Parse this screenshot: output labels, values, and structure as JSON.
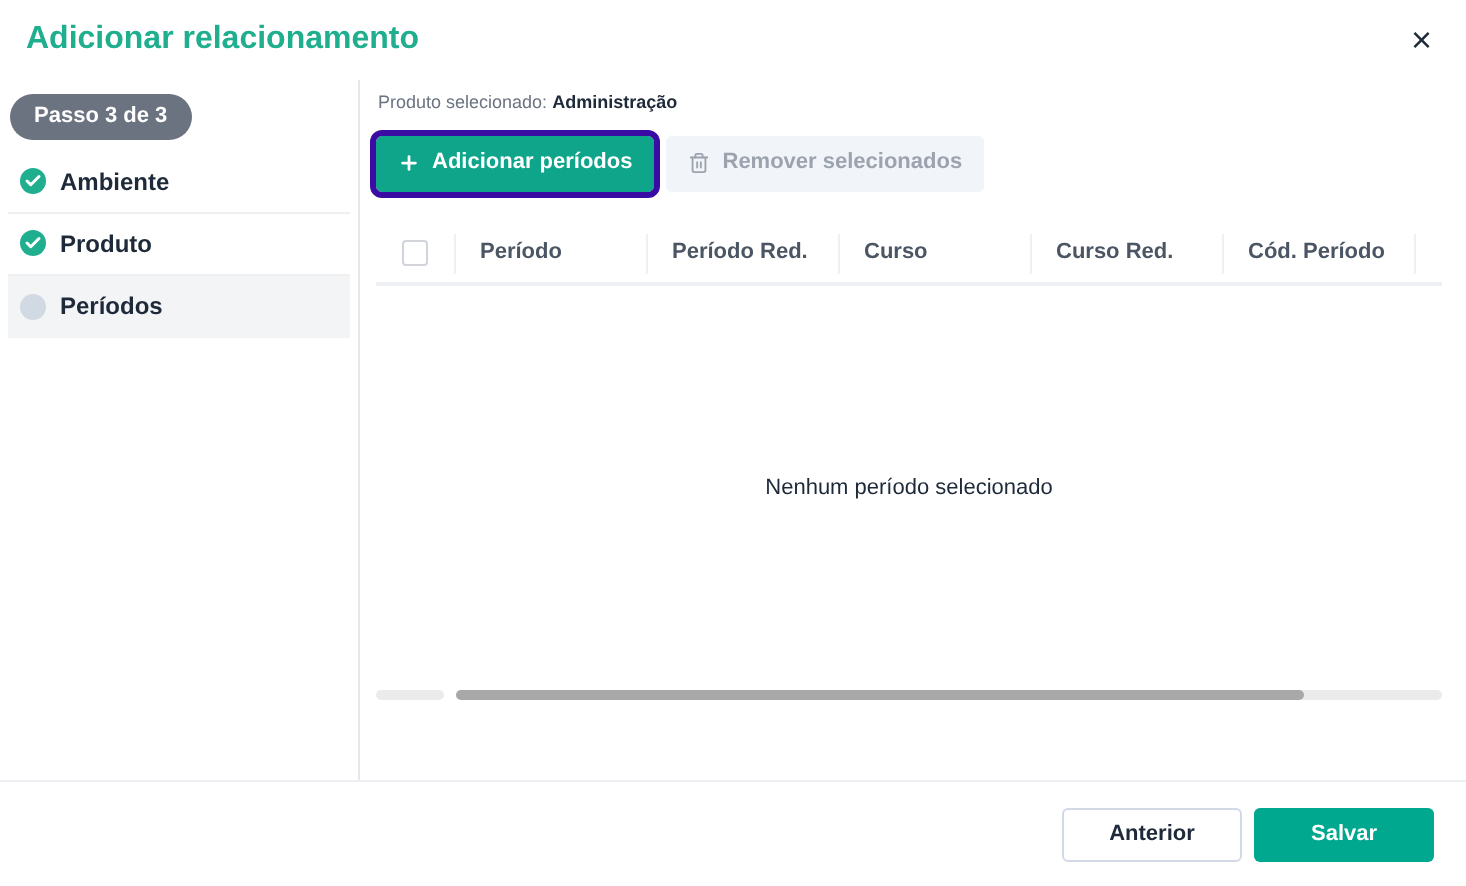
{
  "dialog": {
    "title": "Adicionar relacionamento",
    "close": "×"
  },
  "stepper": {
    "badge": "Passo 3 de 3",
    "steps": [
      {
        "label": "Ambiente",
        "completed": true,
        "selected": false
      },
      {
        "label": "Produto",
        "completed": true,
        "selected": false
      },
      {
        "label": "Períodos",
        "completed": false,
        "selected": true
      }
    ]
  },
  "selected_product": {
    "label": "Produto selecionado:",
    "value": "Administração"
  },
  "toolbar": [
    {
      "label": "Adicionar períodos",
      "kind": "add",
      "disabled": false,
      "focused": true
    },
    {
      "label": "Remover selecionados",
      "kind": "remove",
      "disabled": true,
      "focused": false
    }
  ],
  "table": {
    "select_all_checked": false,
    "columns": [
      "Período",
      "Período Red.",
      "Curso",
      "Curso Red.",
      "Cód. Período"
    ],
    "empty_message": "Nenhum período selecionado"
  },
  "footer": {
    "buttons": [
      {
        "label": "Anterior",
        "kind": "secondary"
      },
      {
        "label": "Salvar",
        "kind": "primary"
      }
    ]
  }
}
